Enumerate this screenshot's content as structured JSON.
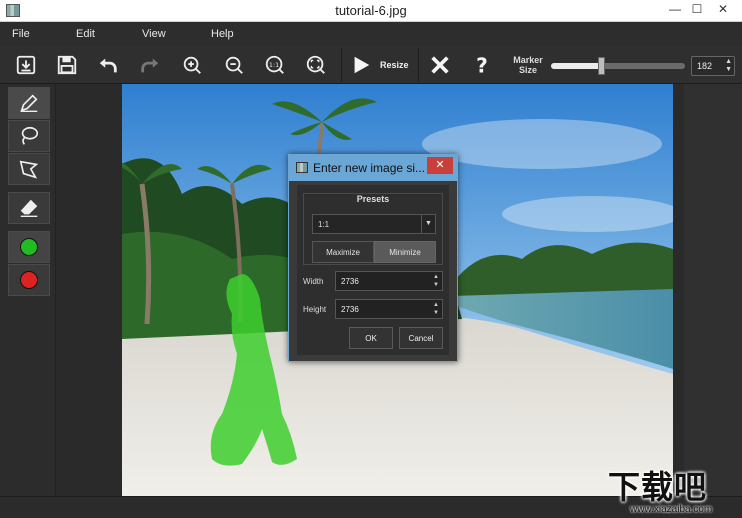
{
  "window": {
    "title": "tutorial-6.jpg",
    "min_glyph": "—",
    "max_glyph": "☐",
    "close_glyph": "✕"
  },
  "menu": {
    "items": [
      {
        "label": "File"
      },
      {
        "label": "Edit"
      },
      {
        "label": "View"
      },
      {
        "label": "Help"
      }
    ]
  },
  "toolbar": {
    "resize_label": "Resize",
    "marker_label": "Marker\nSize",
    "marker_size": "182",
    "marker_fraction": 0.37,
    "icons": [
      "open-file-icon",
      "save-icon",
      "undo-icon",
      "redo-icon",
      "zoom-in-icon",
      "zoom-out-icon",
      "zoom-1to1-icon",
      "zoom-fit-icon",
      "play-icon",
      "clear-x-icon",
      "help-icon"
    ]
  },
  "tools": {
    "keep_color": "#22bb22",
    "remove_color": "#dd2222"
  },
  "dialog": {
    "title": "Enter new image si...",
    "close_glyph": "✕",
    "presets_title": "Presets",
    "preset_value": "1:1",
    "maximize_label": "Maximize",
    "minimize_label": "Minimize",
    "width_label": "Width",
    "width_value": "2736",
    "height_label": "Height",
    "height_value": "2736",
    "ok_label": "OK",
    "cancel_label": "Cancel"
  },
  "watermark": {
    "big": "下载吧",
    "small": "www.xiazaiba.com"
  }
}
